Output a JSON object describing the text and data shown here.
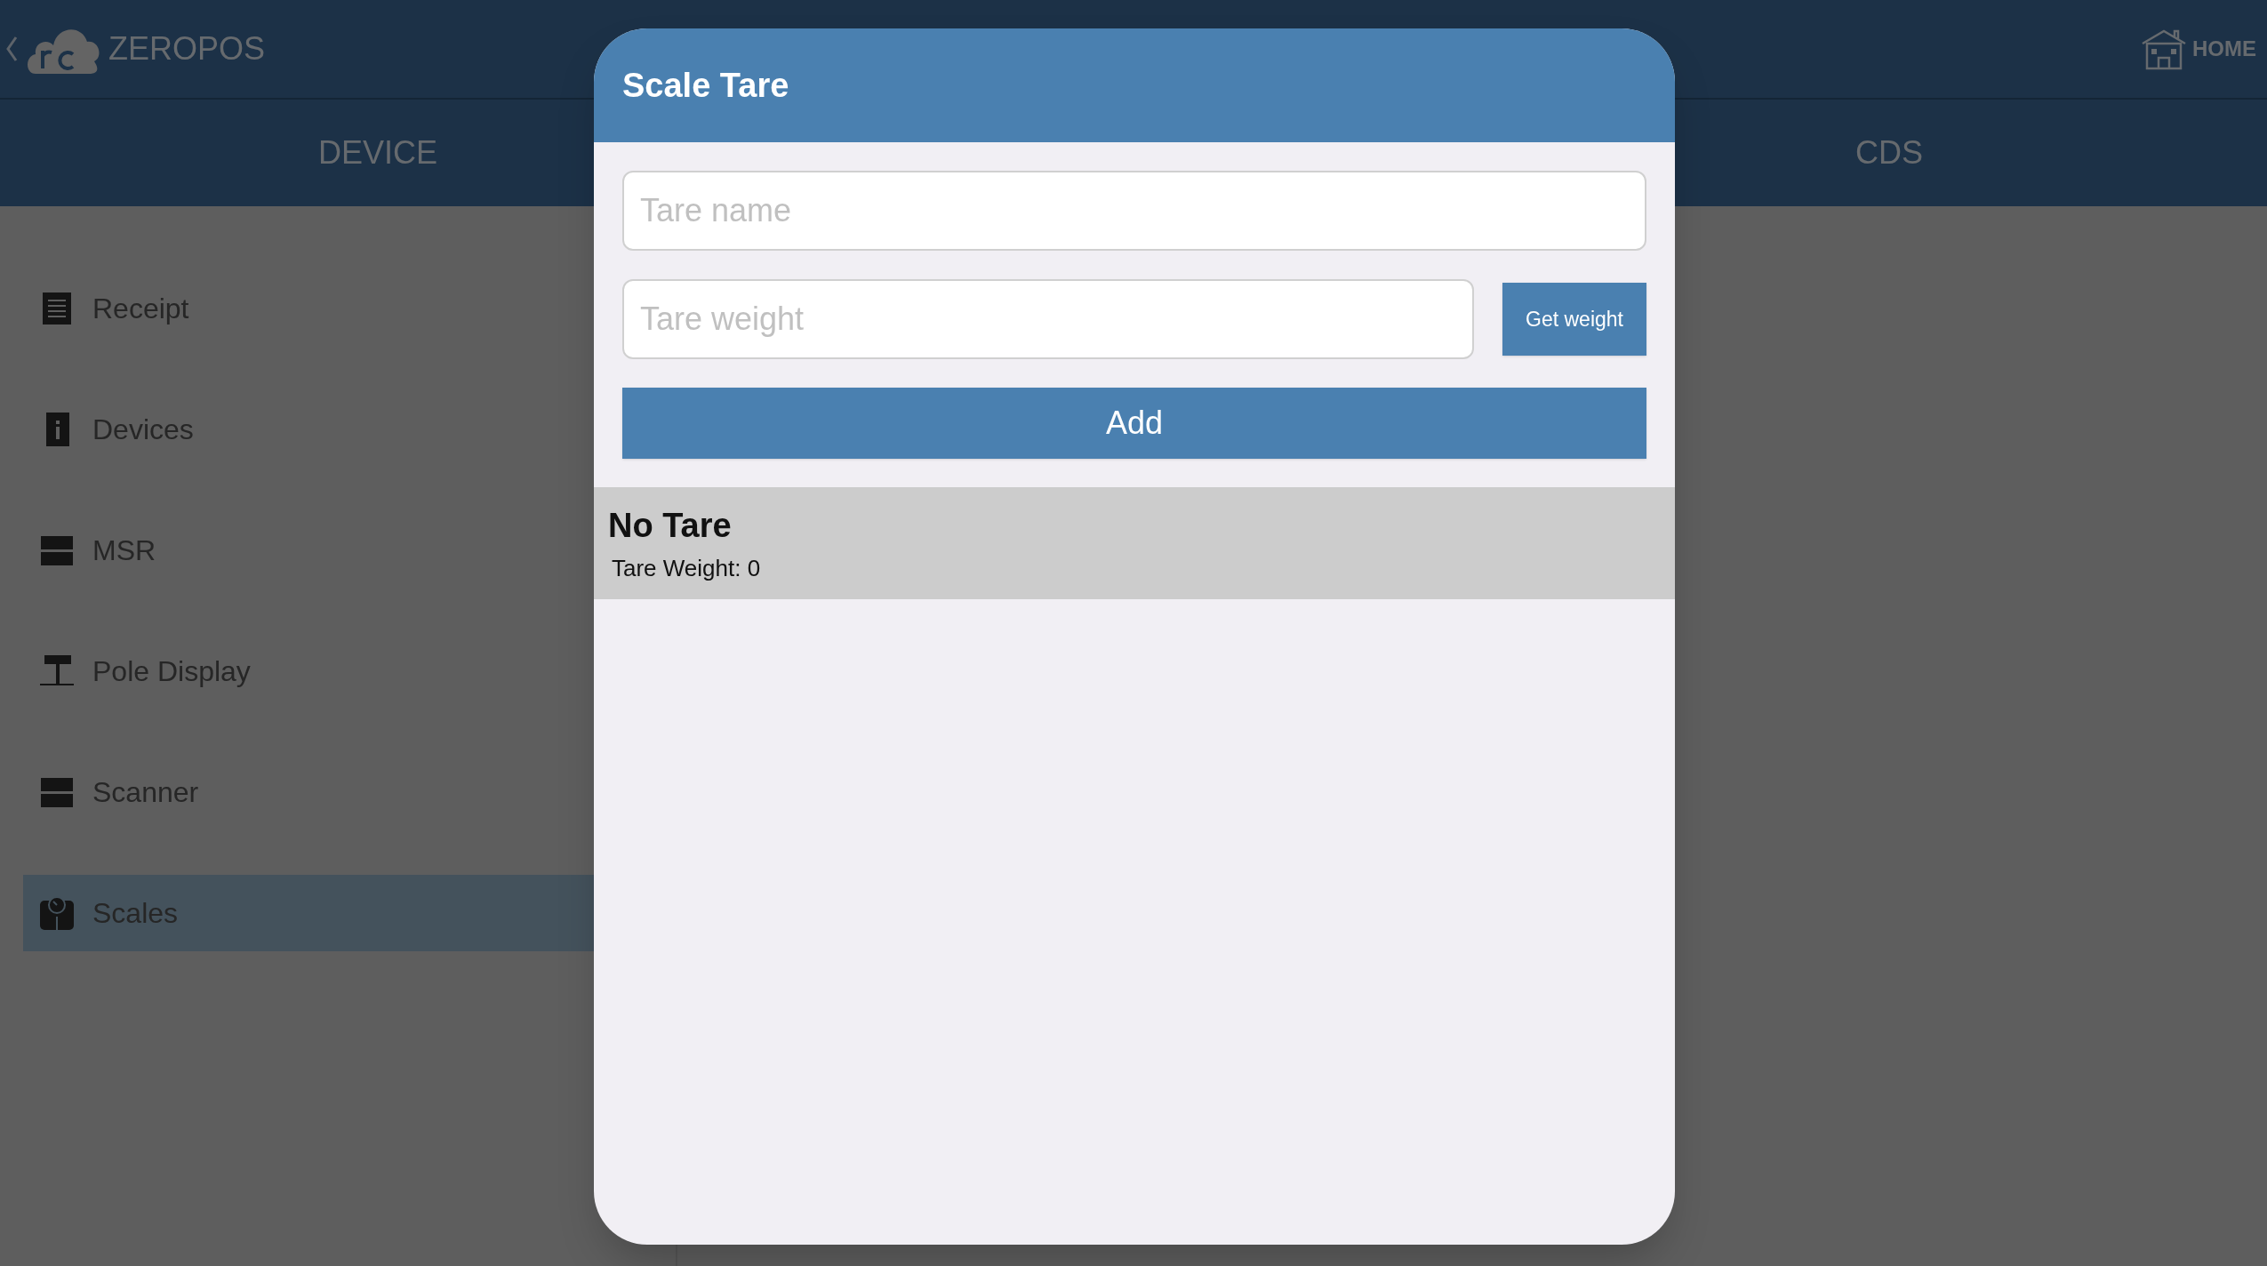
{
  "app": {
    "title": "ZEROPOS",
    "home": "HOME"
  },
  "tabs": [
    {
      "label": "DEVICE"
    },
    {
      "label": "CDS"
    }
  ],
  "sidebar": {
    "items": [
      {
        "label": "Receipt",
        "kind": "receipt",
        "selected": false
      },
      {
        "label": "Devices",
        "kind": "info",
        "selected": false
      },
      {
        "label": "MSR",
        "kind": "bars",
        "selected": false
      },
      {
        "label": "Pole Display",
        "kind": "pole",
        "selected": false
      },
      {
        "label": "Scanner",
        "kind": "bars",
        "selected": false
      },
      {
        "label": "Scales",
        "kind": "scale",
        "selected": true
      }
    ]
  },
  "dialog": {
    "title": "Scale Tare",
    "name_field": {
      "placeholder": "Tare name"
    },
    "weight_field": {
      "placeholder": "Tare weight"
    },
    "get_weight_button": "Get weight",
    "add_button": "Add",
    "tares": [
      {
        "name": "No Tare",
        "weight": "Tare Weight: 0"
      }
    ]
  }
}
